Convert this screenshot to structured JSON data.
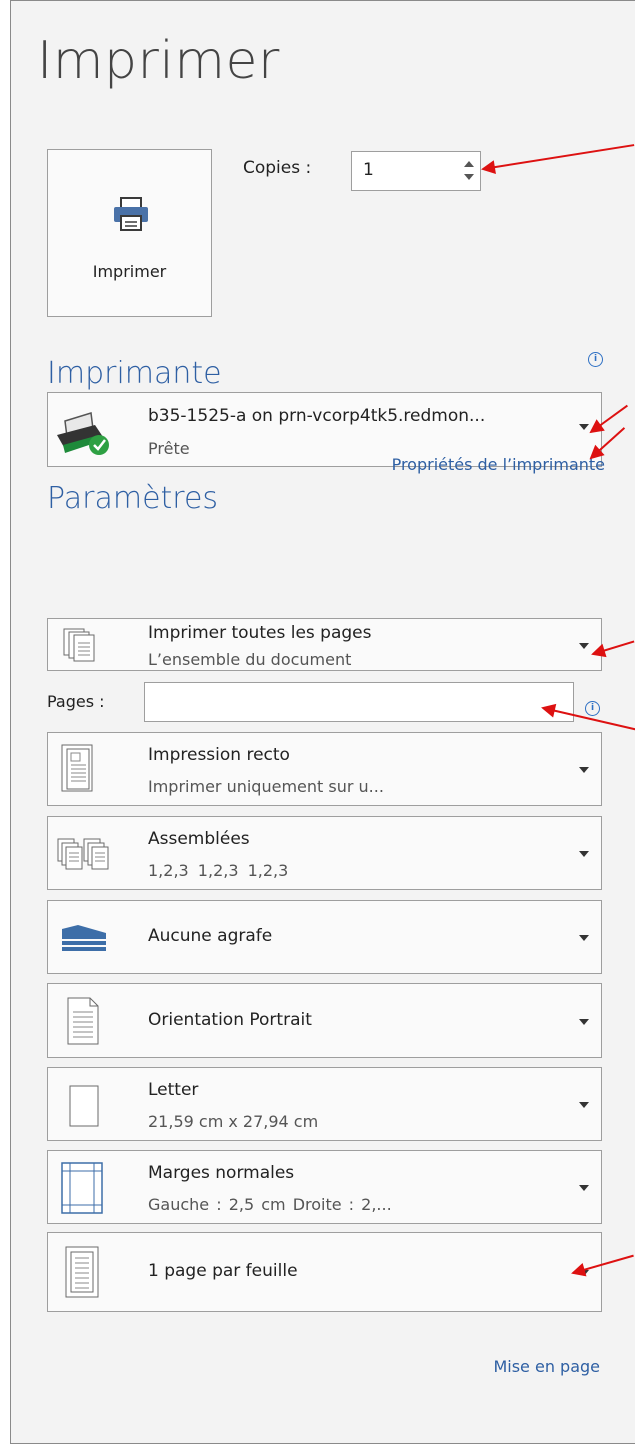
{
  "title": "Imprimer",
  "print_button": {
    "label": "Imprimer"
  },
  "copies": {
    "label": "Copies :",
    "value": "1"
  },
  "printer": {
    "heading": "Imprimante",
    "name": "b35-1525-a on prn-vcorp4tk5.redmon...",
    "status": "Prête",
    "properties_link": "Propriétés de l’imprimante"
  },
  "settings": {
    "heading": "Paramètres",
    "print_range": {
      "title": "Imprimer toutes les pages",
      "subtitle": "L’ensemble du document"
    },
    "pages_label": "Pages :",
    "pages_value": "",
    "sides": {
      "title": "Impression recto",
      "subtitle": "Imprimer uniquement sur u..."
    },
    "collation": {
      "title": "Assemblées",
      "subtitle": "1,2,3   1,2,3   1,2,3"
    },
    "staple": {
      "title": "Aucune agrafe"
    },
    "orientation": {
      "title": "Orientation Portrait"
    },
    "paper": {
      "title": "Letter",
      "subtitle": "21,59 cm x 27,94 cm"
    },
    "margins": {
      "title": "Marges normales",
      "subtitle": "Gauche : 2,5 cm   Droite : 2,..."
    },
    "pages_per_sheet": {
      "title": "1 page par feuille"
    },
    "page_setup_link": "Mise en page"
  },
  "colors": {
    "accent": "#2e5fa3",
    "annotation": "#dd1111"
  },
  "icons": [
    "printer-icon",
    "printer-device-icon",
    "ready-check-icon",
    "pages-stack-icon",
    "one-sided-icon",
    "collated-icon",
    "staple-icon",
    "portrait-icon",
    "letter-page-icon",
    "margins-icon",
    "pages-per-sheet-icon",
    "info-icon",
    "chevron-down-icon",
    "spin-up-icon",
    "spin-down-icon"
  ]
}
